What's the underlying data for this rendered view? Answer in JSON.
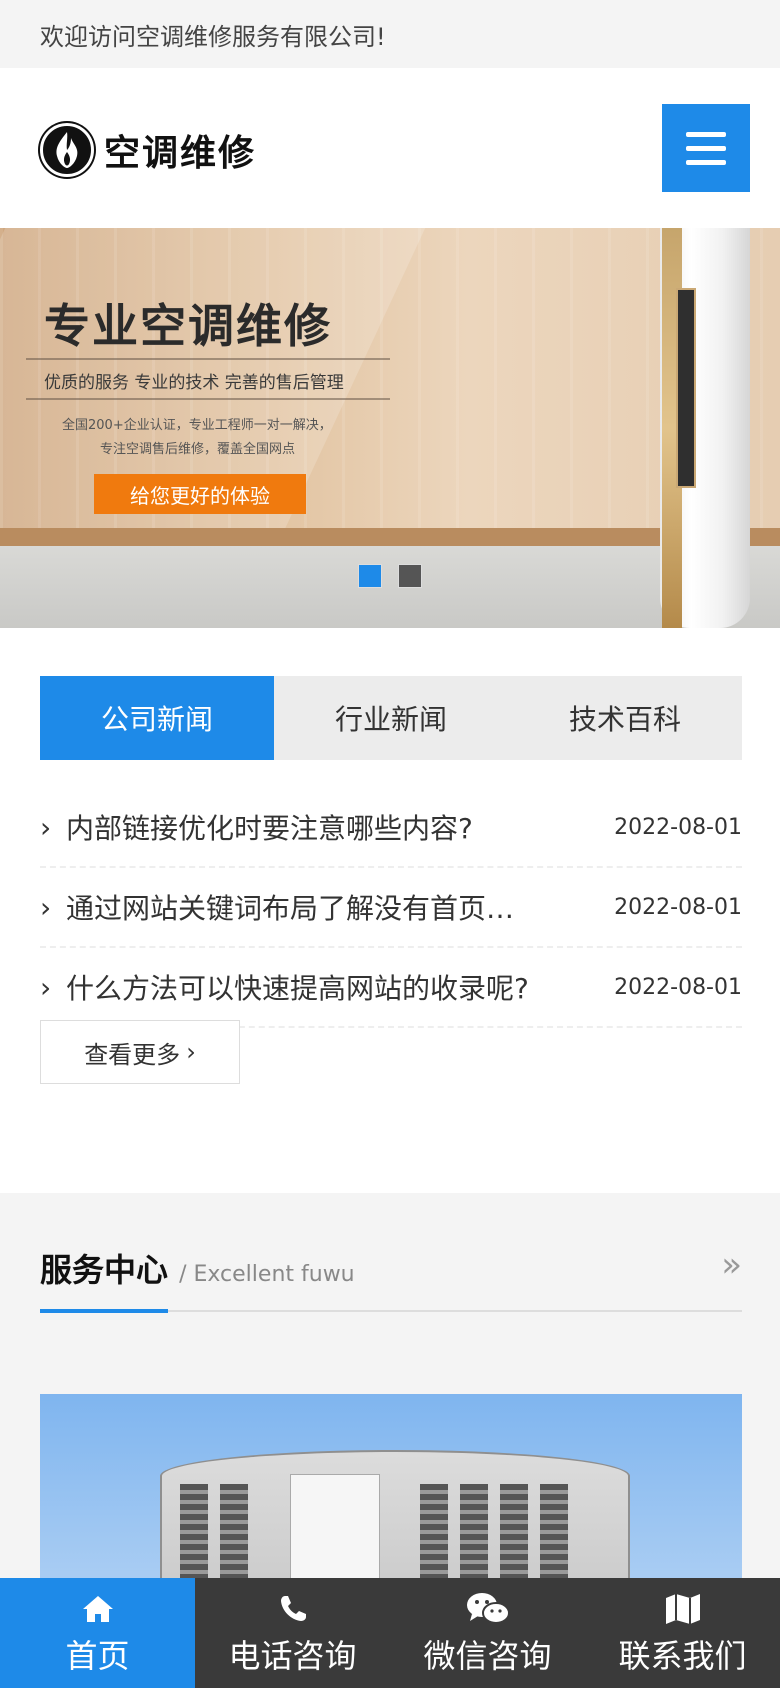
{
  "topbar": {
    "welcome": "欢迎访问空调维修服务有限公司!"
  },
  "header": {
    "logo_text": "空调维修",
    "menu_icon": "hamburger-menu-icon"
  },
  "banner": {
    "title": "专业空调维修",
    "subtitle": "优质的服务  专业的技术  完善的售后管理",
    "desc_line1": "全国200+企业认证，专业工程师一对一解决，",
    "desc_line2": "专注空调售后维修，覆盖全国网点",
    "cta": "给您更好的体验",
    "active_slide": 1,
    "slide_count": 2
  },
  "news": {
    "tabs": [
      "公司新闻",
      "行业新闻",
      "技术百科"
    ],
    "active_tab": 0,
    "items": [
      {
        "title": "内部链接优化时要注意哪些内容?",
        "date": "2022-08-01"
      },
      {
        "title": "通过网站关键词布局了解没有首页排名的原因",
        "date": "2022-08-01"
      },
      {
        "title": "什么方法可以快速提高网站的收录呢?",
        "date": "2022-08-01"
      }
    ],
    "more": "查看更多",
    "more_arrow": "›"
  },
  "service": {
    "title": "服务中心",
    "subtitle": "/ Excellent fuwu",
    "more_icon": "double-chevron-right-icon"
  },
  "bottom_nav": [
    {
      "label": "首页",
      "icon": "home-icon"
    },
    {
      "label": "电话咨询",
      "icon": "phone-icon"
    },
    {
      "label": "微信咨询",
      "icon": "wechat-icon"
    },
    {
      "label": "联系我们",
      "icon": "map-icon"
    }
  ],
  "colors": {
    "accent": "#1e8ae8",
    "cta": "#f07a0e",
    "nav_bg": "#3a3a3a"
  }
}
